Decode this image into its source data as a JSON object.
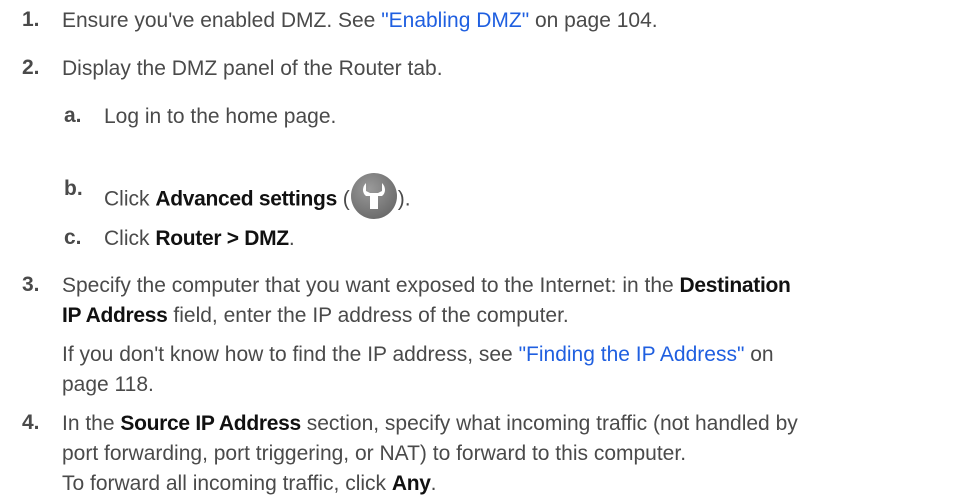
{
  "steps": {
    "s1": {
      "num": "1.",
      "text_a": "Ensure you've enabled DMZ. See ",
      "link": "\"Enabling DMZ\"",
      "text_b": " on page 104."
    },
    "s2": {
      "num": "2.",
      "text": "Display the DMZ panel of the Router tab.",
      "a": {
        "num": "a.",
        "text": "Log in to the home page."
      },
      "b": {
        "num": "b.",
        "text_a": "Click ",
        "ui": "Advanced settings",
        "text_b": " (",
        "text_c": ").",
        "icon": "wrench-icon"
      },
      "c": {
        "num": "c.",
        "text_a": "Click ",
        "ui": "Router > DMZ",
        "text_b": "."
      }
    },
    "s3": {
      "num": "3.",
      "line1_a": "Specify the computer that you want exposed to the Internet: in the ",
      "line1_ui": "Destination",
      "line2_ui": "IP Address",
      "line2_b": " field, enter the IP address of the computer.",
      "note_a": "If you don't know how to find the IP address, see ",
      "note_link": "\"Finding the IP Address\"",
      "note_b": " on",
      "note_c": "page 118."
    },
    "s4": {
      "num": "4.",
      "line1_a": "In the ",
      "line1_ui": "Source IP Address",
      "line1_b": " section, specify what incoming traffic (not handled by",
      "line2": "port forwarding, port triggering, or NAT) to forward to this computer.",
      "note_a": "To forward all incoming traffic, click ",
      "note_ui": "Any",
      "note_b": "."
    }
  },
  "colors": {
    "text": "#4a4a4a",
    "link": "#1f5fe0",
    "ui_text": "#111111"
  }
}
